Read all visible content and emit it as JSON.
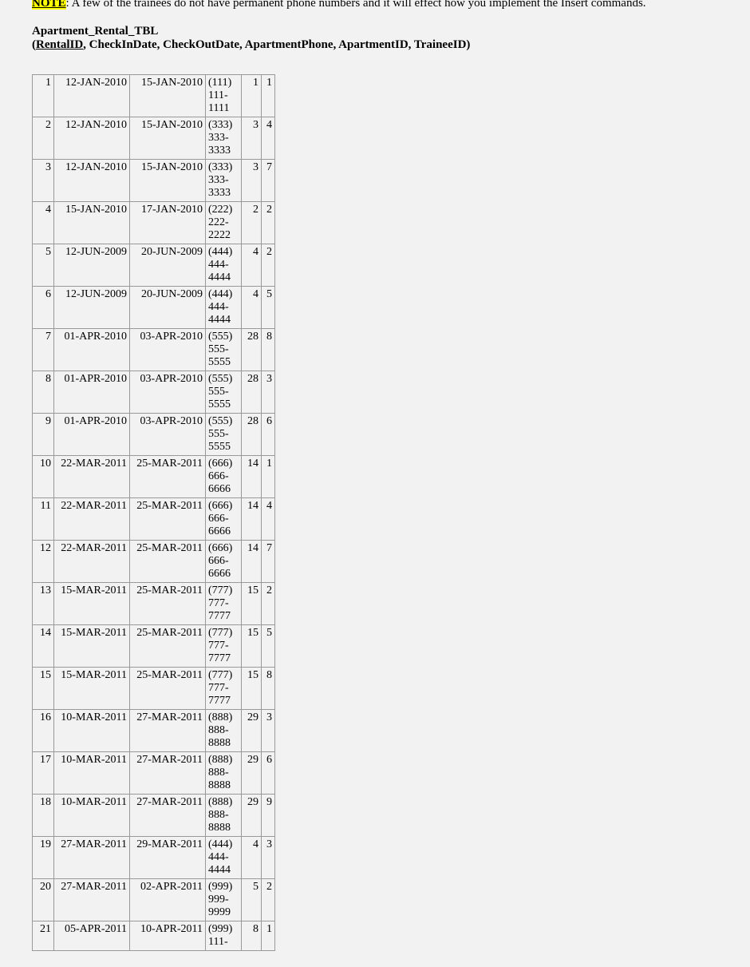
{
  "top_note": {
    "highlight": "NOTE",
    "rest": ": A few of the trainees do not have permanent phone numbers and it will effect how you implement the Insert commands."
  },
  "table_spec": {
    "title": "Apartment_Rental_TBL",
    "open": "(",
    "pk": "RentalID",
    "rest": ", CheckInDate, CheckOutDate, ApartmentPhone, ApartmentID, TraineeID",
    "close": ")"
  },
  "rows": [
    {
      "id": "1",
      "in": "12-JAN-2010",
      "out": "15-JAN-2010",
      "phone": "(111) 111-1111",
      "apt": "1",
      "tr": "1"
    },
    {
      "id": "2",
      "in": "12-JAN-2010",
      "out": "15-JAN-2010",
      "phone": "(333) 333-3333",
      "apt": "3",
      "tr": "4"
    },
    {
      "id": "3",
      "in": "12-JAN-2010",
      "out": "15-JAN-2010",
      "phone": "(333) 333-3333",
      "apt": "3",
      "tr": "7"
    },
    {
      "id": "4",
      "in": "15-JAN-2010",
      "out": "17-JAN-2010",
      "phone": "(222) 222-2222",
      "apt": "2",
      "tr": "2"
    },
    {
      "id": "5",
      "in": "12-JUN-2009",
      "out": "20-JUN-2009",
      "phone": "(444) 444-4444",
      "apt": "4",
      "tr": "2"
    },
    {
      "id": "6",
      "in": "12-JUN-2009",
      "out": "20-JUN-2009",
      "phone": "(444) 444-4444",
      "apt": "4",
      "tr": "5"
    },
    {
      "id": "7",
      "in": "01-APR-2010",
      "out": "03-APR-2010",
      "phone": "(555) 555-5555",
      "apt": "28",
      "tr": "8"
    },
    {
      "id": "8",
      "in": "01-APR-2010",
      "out": "03-APR-2010",
      "phone": "(555) 555-5555",
      "apt": "28",
      "tr": "3"
    },
    {
      "id": "9",
      "in": "01-APR-2010",
      "out": "03-APR-2010",
      "phone": "(555) 555-5555",
      "apt": "28",
      "tr": "6"
    },
    {
      "id": "10",
      "in": "22-MAR-2011",
      "out": "25-MAR-2011",
      "phone": "(666) 666-6666",
      "apt": "14",
      "tr": "1"
    },
    {
      "id": "11",
      "in": "22-MAR-2011",
      "out": "25-MAR-2011",
      "phone": "(666) 666-6666",
      "apt": "14",
      "tr": "4"
    },
    {
      "id": "12",
      "in": "22-MAR-2011",
      "out": "25-MAR-2011",
      "phone": "(666) 666-6666",
      "apt": "14",
      "tr": "7"
    },
    {
      "id": "13",
      "in": "15-MAR-2011",
      "out": "25-MAR-2011",
      "phone": "(777) 777-7777",
      "apt": "15",
      "tr": "2"
    },
    {
      "id": "14",
      "in": "15-MAR-2011",
      "out": "25-MAR-2011",
      "phone": "(777) 777-7777",
      "apt": "15",
      "tr": "5"
    },
    {
      "id": "15",
      "in": "15-MAR-2011",
      "out": "25-MAR-2011",
      "phone": "(777) 777-7777",
      "apt": "15",
      "tr": "8"
    },
    {
      "id": "16",
      "in": "10-MAR-2011",
      "out": "27-MAR-2011",
      "phone": "(888) 888-8888",
      "apt": "29",
      "tr": "3"
    },
    {
      "id": "17",
      "in": "10-MAR-2011",
      "out": "27-MAR-2011",
      "phone": "(888) 888-8888",
      "apt": "29",
      "tr": "6"
    },
    {
      "id": "18",
      "in": "10-MAR-2011",
      "out": "27-MAR-2011",
      "phone": "(888) 888-8888",
      "apt": "29",
      "tr": "9"
    },
    {
      "id": "19",
      "in": "27-MAR-2011",
      "out": "29-MAR-2011",
      "phone": "(444) 444-4444",
      "apt": "4",
      "tr": "3"
    },
    {
      "id": "20",
      "in": "27-MAR-2011",
      "out": "02-APR-2011",
      "phone": "(999) 999-9999",
      "apt": "5",
      "tr": "2"
    },
    {
      "id": "21",
      "in": "05-APR-2011",
      "out": "10-APR-2011",
      "phone": "(999) 111-",
      "apt": "8",
      "tr": "1"
    }
  ]
}
